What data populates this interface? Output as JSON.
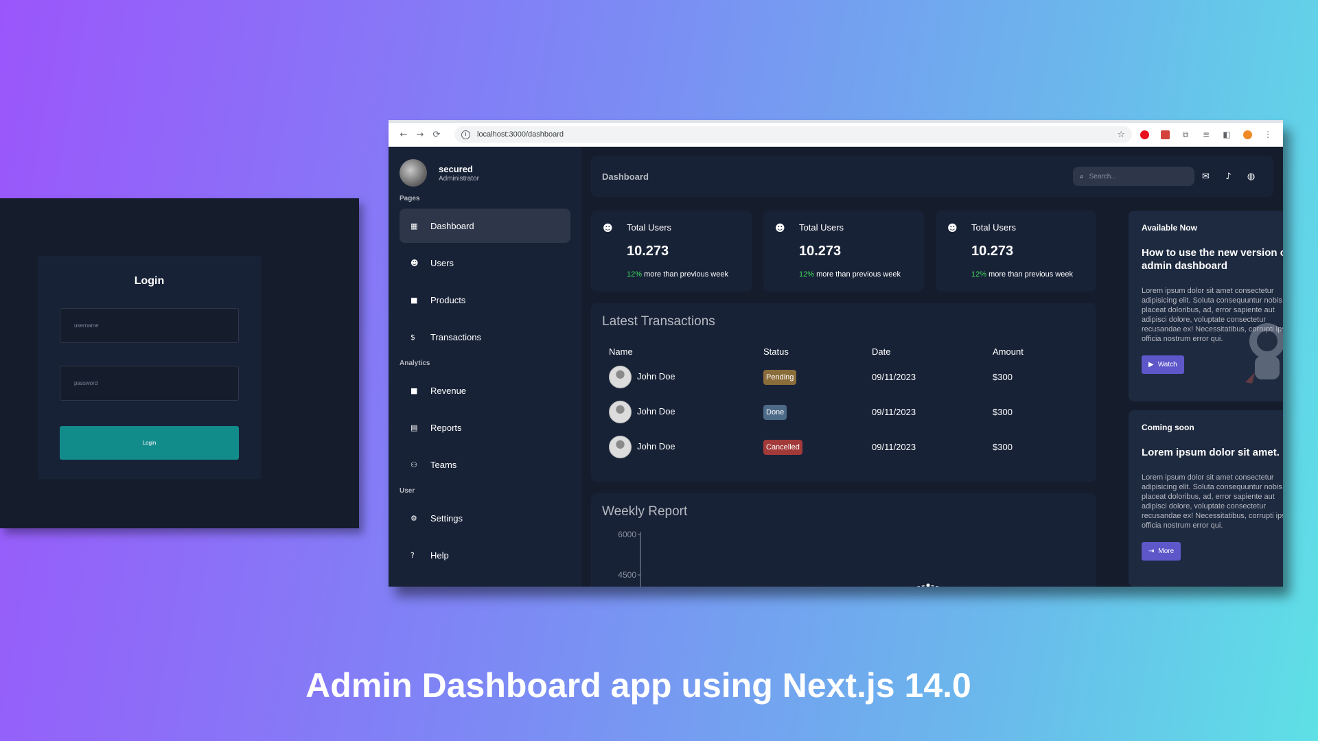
{
  "login": {
    "title": "Login",
    "username_placeholder": "username",
    "password_placeholder": "password",
    "button_label": "Login"
  },
  "browser": {
    "url": "localhost:3000/dashboard",
    "back": "←",
    "forward": "→",
    "reload": "⟳",
    "info": "i",
    "star": "☆"
  },
  "sidebar": {
    "user_name": "secured",
    "user_role": "Administrator",
    "sections": [
      {
        "title": "Pages"
      },
      {
        "title": "Analytics"
      },
      {
        "title": "User"
      }
    ],
    "items": [
      {
        "label": "Dashboard",
        "icon": "grid-icon",
        "glyph": "▦"
      },
      {
        "label": "Users",
        "icon": "users-icon",
        "glyph": "☻"
      },
      {
        "label": "Products",
        "icon": "bag-icon",
        "glyph": "■"
      },
      {
        "label": "Transactions",
        "icon": "dollar-icon",
        "glyph": "$"
      },
      {
        "label": "Revenue",
        "icon": "briefcase-icon",
        "glyph": "■"
      },
      {
        "label": "Reports",
        "icon": "chart-icon",
        "glyph": "▤"
      },
      {
        "label": "Teams",
        "icon": "team-icon",
        "glyph": "⚇"
      },
      {
        "label": "Settings",
        "icon": "gear-icon",
        "glyph": "⚙"
      },
      {
        "label": "Help",
        "icon": "help-icon",
        "glyph": "?"
      }
    ]
  },
  "topbar": {
    "title": "Dashboard",
    "search_placeholder": "Search...",
    "search_glyph": "⌕",
    "message_glyph": "✉",
    "bell_glyph": "♪",
    "globe_glyph": "◍"
  },
  "cards": [
    {
      "title": "Total Users",
      "value": "10.273",
      "pct": "12%",
      "detail": " more than previous week",
      "glyph": "☻"
    },
    {
      "title": "Total Users",
      "value": "10.273",
      "pct": "12%",
      "detail": " more than previous week",
      "glyph": "☻"
    },
    {
      "title": "Total Users",
      "value": "10.273",
      "pct": "12%",
      "detail": " more than previous week",
      "glyph": "☻"
    }
  ],
  "transactions": {
    "title": "Latest Transactions",
    "headers": [
      "Name",
      "Status",
      "Date",
      "Amount"
    ],
    "rows": [
      {
        "name": "John Doe",
        "status": "Pending",
        "date": "09/11/2023",
        "amount": "$300"
      },
      {
        "name": "John Doe",
        "status": "Done",
        "date": "09/11/2023",
        "amount": "$300"
      },
      {
        "name": "John Doe",
        "status": "Cancelled",
        "date": "09/11/2023",
        "amount": "$300"
      }
    ]
  },
  "weekly": {
    "title": "Weekly Report",
    "chart_data": {
      "type": "line",
      "yticks": [
        "6000",
        "4500"
      ],
      "ylim": [
        4500,
        6000
      ]
    }
  },
  "promos": [
    {
      "tag": "Available Now",
      "title": "How to use the new version of admin dashboard",
      "text": "Lorem ipsum dolor sit amet consectetur adipisicing elit. Soluta consequuntur nobis placeat doloribus, ad, error sapiente aut adipisci dolore, voluptate consectetur recusandae ex! Necessitatibus, corrupti ipsa officia nostrum error qui.",
      "button": "Watch",
      "button_glyph": "▶"
    },
    {
      "tag": "Coming soon",
      "title": "Lorem ipsum dolor sit amet.",
      "text": "Lorem ipsum dolor sit amet consectetur adipisicing elit. Soluta consequuntur nobis placeat doloribus, ad, error sapiente aut adipisci dolore, voluptate consectetur recusandae ex! Necessitatibus, corrupti ipsa officia nostrum error qui.",
      "button": "More",
      "button_glyph": "⇥"
    }
  ],
  "headline": "Admin Dashboard app using Next.js 14.0",
  "colors": {
    "accent_green": "#3ddc5b",
    "login_button": "#128b8b",
    "promo_button": "#5d57c9"
  }
}
